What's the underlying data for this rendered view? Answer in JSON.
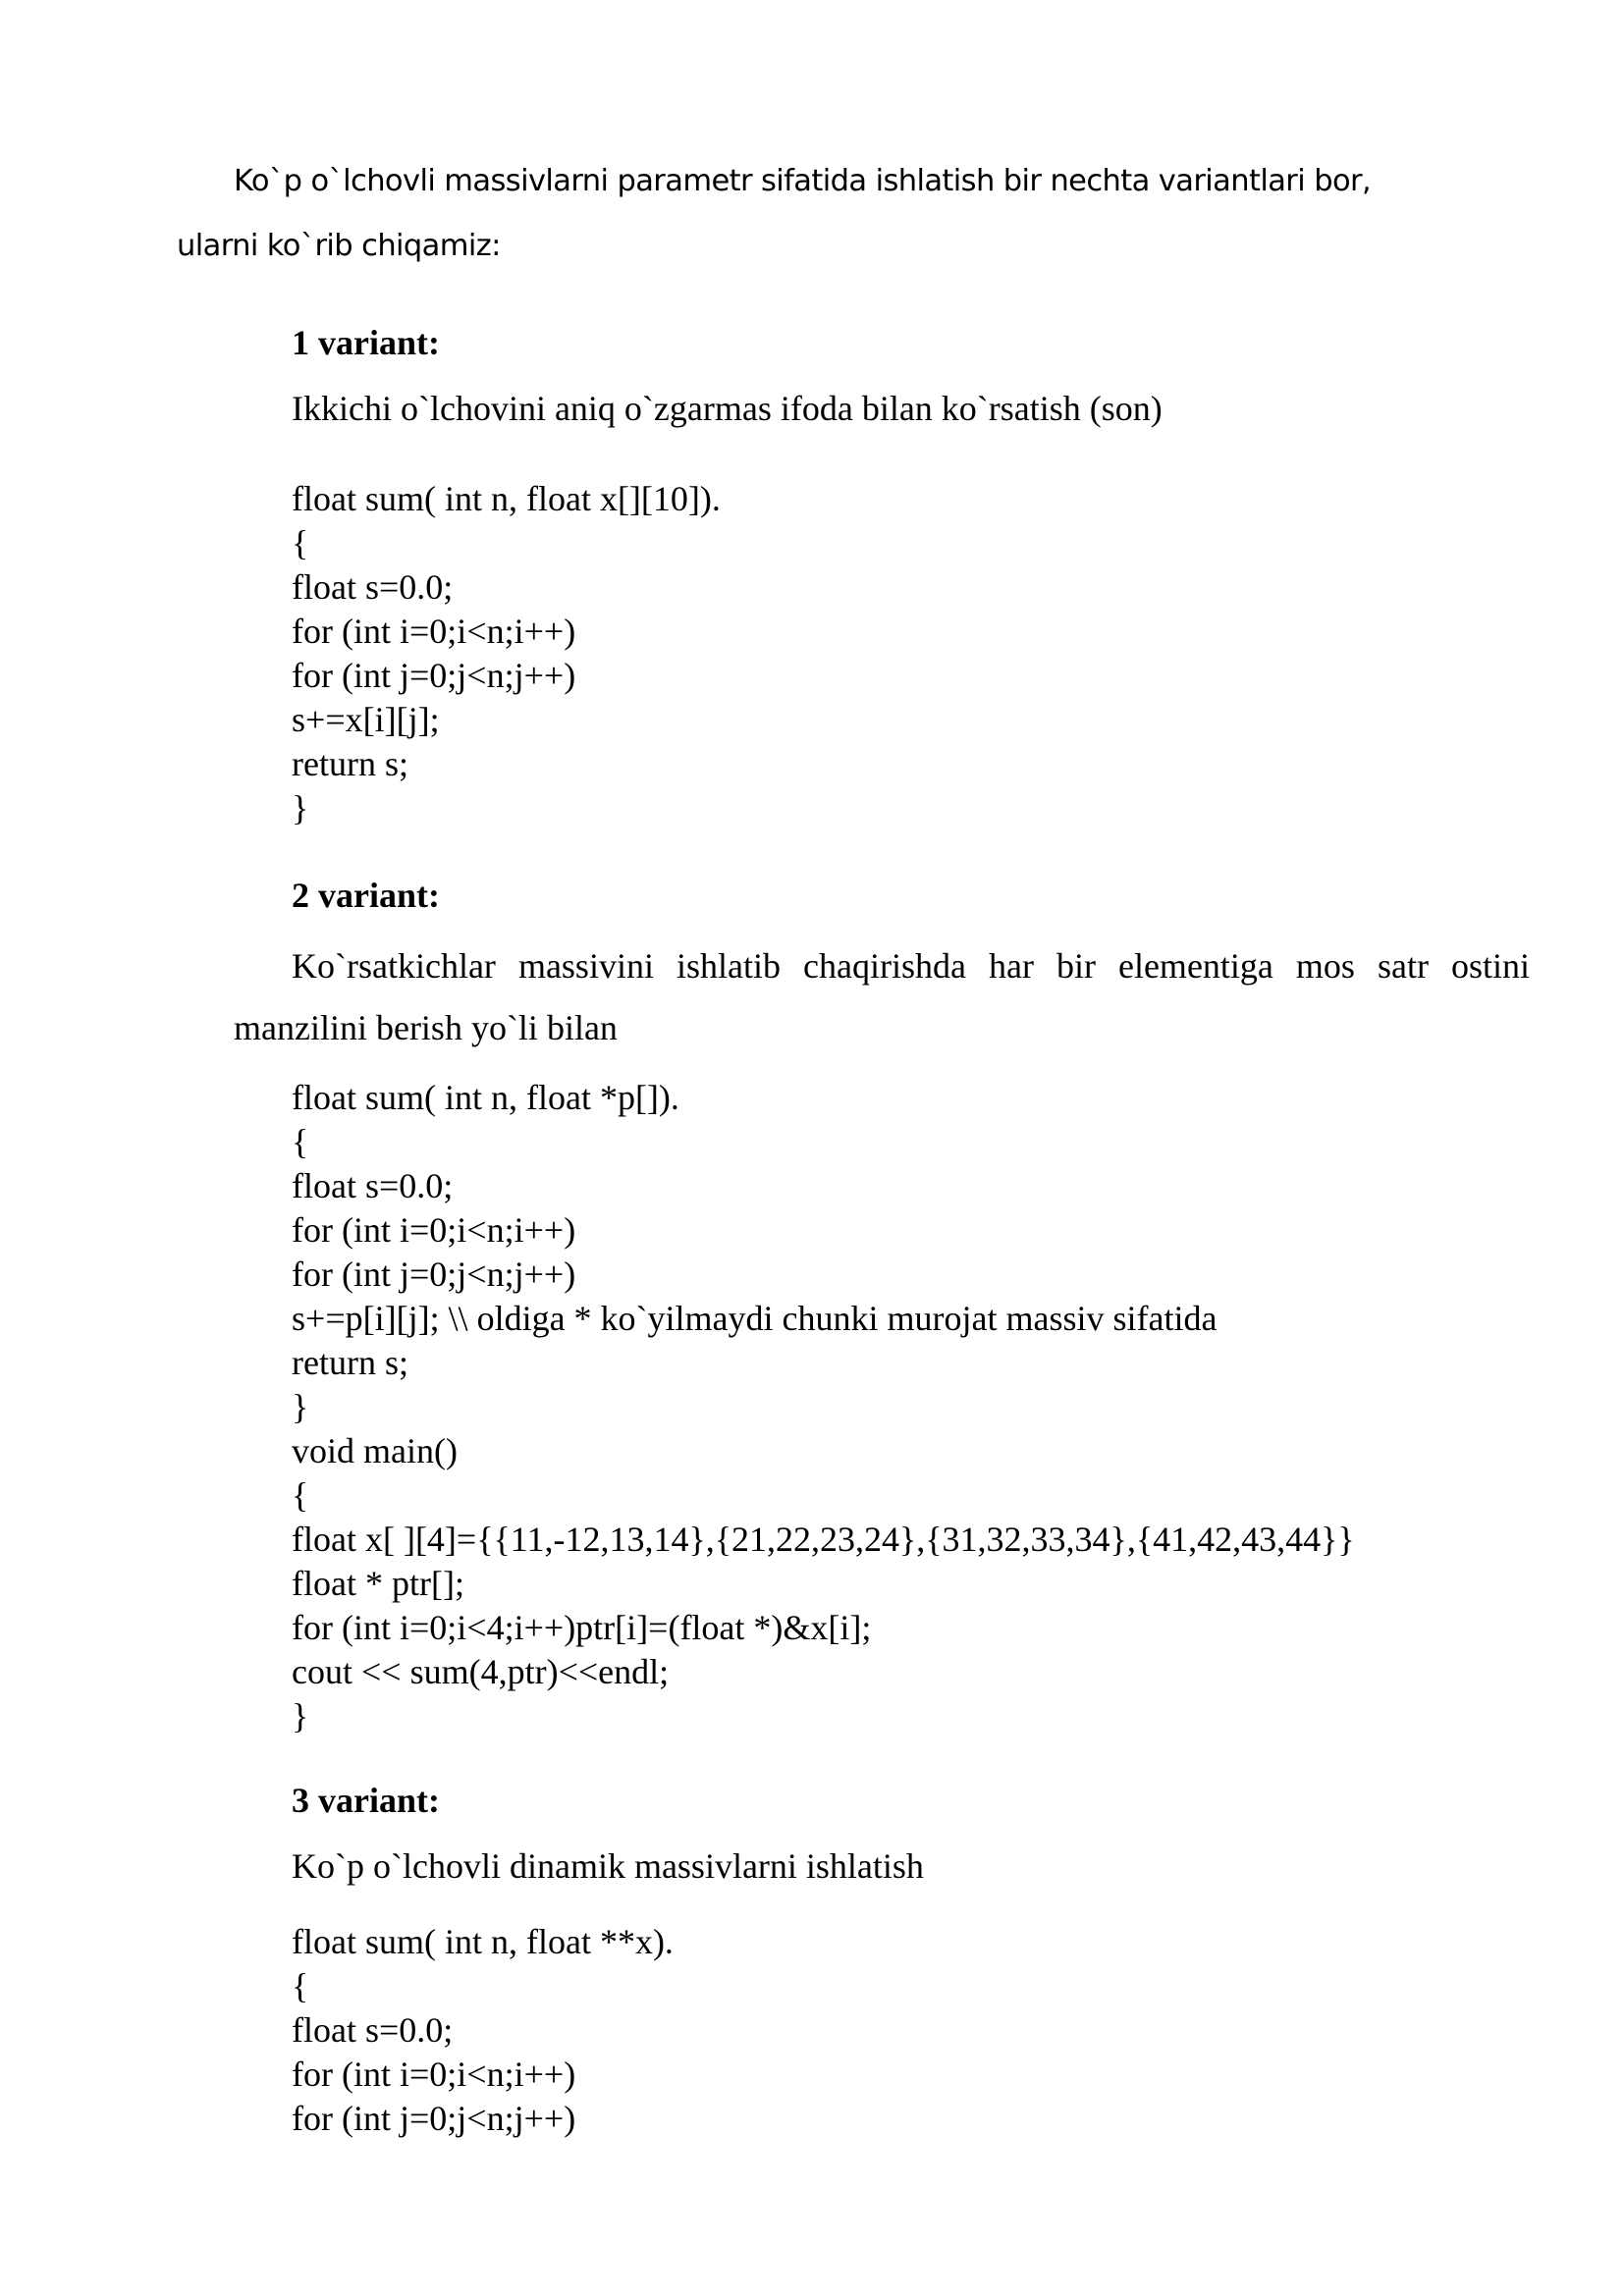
{
  "intro": {
    "line1": "Ko`p o`lchovli massivlarni parametr sifatida ishlatish bir nechta variantlari bor,",
    "line2": "ularni ko`rib chiqamiz:"
  },
  "variant1": {
    "heading": "1 variant:",
    "description": "Ikkichi o`lchovini aniq o`zgarmas ifoda bilan ko`rsatish (son)",
    "code": [
      "float sum( int n, float x[][10]).",
      "{",
      "float s=0.0;",
      "for (int i=0;i<n;i++)",
      "for (int j=0;j<n;j++)",
      "s+=x[i][j];",
      "return s;",
      "}"
    ]
  },
  "variant2": {
    "heading": "2 variant:",
    "description_line1": "Ko`rsatkichlar massivini ishlatib chaqirishda har bir elementiga mos satr ostini",
    "description_line2": "manzilini berish yo`li bilan",
    "code": [
      "float sum( int n, float *p[]).",
      "{",
      "float s=0.0;",
      "for (int i=0;i<n;i++)",
      "for (int j=0;j<n;j++)",
      "s+=p[i][j]; \\\\ oldiga * ko`yilmaydi chunki murojat massiv sifatida",
      "return s;",
      "}",
      "void main()",
      "{",
      "float x[ ][4]={{11,-12,13,14},{21,22,23,24},{31,32,33,34},{41,42,43,44}}",
      "float * ptr[];",
      "for (int i=0;i<4;i++)ptr[i]=(float *)&x[i];",
      "cout << sum(4,ptr)<<endl;",
      "}"
    ]
  },
  "variant3": {
    "heading": "3 variant:",
    "description": "Ko`p o`lchovli dinamik massivlarni ishlatish",
    "code": [
      "float sum( int n, float **x).",
      "{",
      "float s=0.0;",
      "for (int i=0;i<n;i++)",
      "for (int j=0;j<n;j++)"
    ]
  }
}
